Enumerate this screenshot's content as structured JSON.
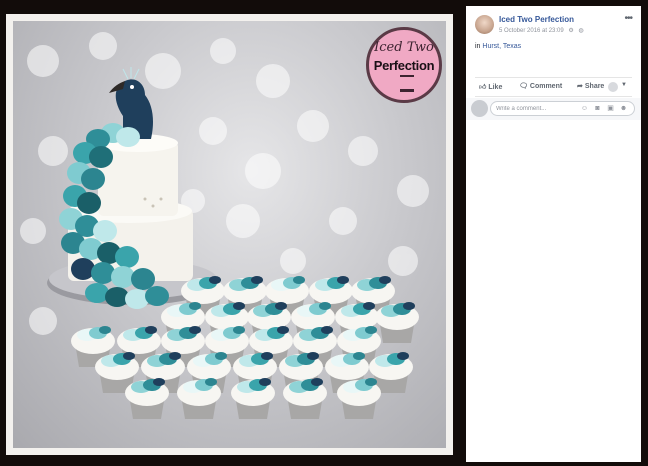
{
  "post": {
    "page_name": "Iced Two Perfection",
    "date": "5 October 2016 at 23:09",
    "location_prefix": "in",
    "location": "Hurst, Texas"
  },
  "actions": {
    "like": "Like",
    "comment": "Comment",
    "share": "Share"
  },
  "comment_box": {
    "placeholder": "Write a comment..."
  },
  "photo": {
    "logo_script": "Iced Two",
    "logo_word": "Perfection",
    "subject": "peacock cake and cupcakes"
  },
  "icons": {
    "more": "more-options-icon",
    "privacy": "globe-icon",
    "like": "thumbs-up-icon",
    "comment": "speech-bubble-icon",
    "share": "share-arrow-icon",
    "emoji": "emoji-icon",
    "camera": "camera-icon",
    "gif": "gif-icon",
    "sticker": "sticker-icon"
  },
  "colors": {
    "link": "#365899",
    "teal": "#3a9aa4",
    "navy": "#1f3f5c",
    "badge": "#f0a9c4"
  }
}
